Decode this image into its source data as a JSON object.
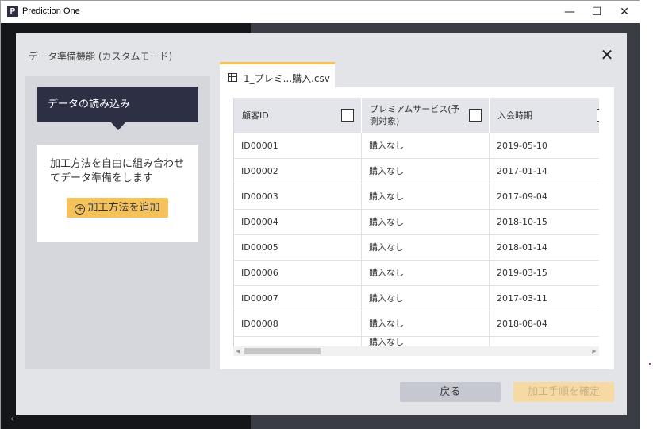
{
  "window": {
    "logo_letter": "P",
    "title": "Prediction One",
    "minimize": "—",
    "maximize": "☐",
    "close": "✕"
  },
  "backdrop": {
    "back_arrow": "‹"
  },
  "dialog": {
    "title": "データ準備機能 (カスタムモード)",
    "close": "✕",
    "step_label": "データの読み込み",
    "info_text": "加工方法を自由に組み合わせてデータ準備をします",
    "add_button_label": "加工方法を追加",
    "tab_label": "1_プレミ...購入.csv",
    "back_button_label": "戻る",
    "confirm_button_label": "加工手順を確定"
  },
  "table": {
    "columns": [
      {
        "label": "顧客ID",
        "checked": false
      },
      {
        "label": "プレミアムサービス(予測対象)",
        "checked": false
      },
      {
        "label": "入会時期",
        "checked": false
      }
    ],
    "rows": [
      [
        "ID00001",
        "購入なし",
        "2019-05-10"
      ],
      [
        "ID00002",
        "購入なし",
        "2017-01-14"
      ],
      [
        "ID00003",
        "購入なし",
        "2017-09-04"
      ],
      [
        "ID00004",
        "購入なし",
        "2018-10-15"
      ],
      [
        "ID00005",
        "購入なし",
        "2018-01-14"
      ],
      [
        "ID00006",
        "購入なし",
        "2019-03-15"
      ],
      [
        "ID00007",
        "購入なし",
        "2017-03-11"
      ],
      [
        "ID00008",
        "購入なし",
        "2018-08-04"
      ],
      [
        "",
        "購入なし",
        ""
      ]
    ]
  },
  "colors": {
    "accent": "#f4c15a",
    "step_card": "#2d3044",
    "secondary_button": "#c6c8d1",
    "disabled_primary": "#f6d9a3"
  }
}
